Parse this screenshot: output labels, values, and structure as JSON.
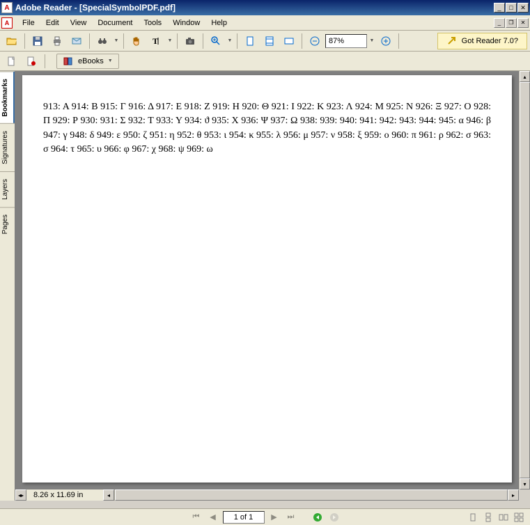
{
  "window": {
    "title": "Adobe Reader - [SpecialSymbolPDF.pdf]"
  },
  "menu": {
    "file": "File",
    "edit": "Edit",
    "view": "View",
    "document": "Document",
    "tools": "Tools",
    "window": "Window",
    "help": "Help"
  },
  "toolbar": {
    "zoom_value": "87%",
    "promo": "Got Reader 7.0?"
  },
  "toolbar2": {
    "ebooks": "eBooks"
  },
  "sidetabs": {
    "bookmarks": "Bookmarks",
    "signatures": "Signatures",
    "layers": "Layers",
    "pages": "Pages"
  },
  "document": {
    "content": " 913: Α 914: Β 915: Γ 916: Δ 917: Ε 918: Ζ 919: Η 920: Θ 921: Ι 922: Κ 923: Λ 924: Μ 925: Ν 926: Ξ 927: Ο 928: Π 929: Ρ 930:  931: Σ 932: Τ 933: Υ 934: ϑ 935: Χ 936: Ψ 937: Ω 938:  939:  940:  941:  942:  943:  944:  945: α 946: β 947: γ 948: δ 949: ε 950: ζ 951: η 952: θ 953: ι 954: κ 955: λ 956: μ 957: ν 958: ξ 959: ο 960: π 961: ρ 962: σ 963: σ 964: τ 965: υ 966: φ 967: χ 968: ψ 969: ω"
  },
  "status": {
    "dimensions": "8.26 x 11.69 in",
    "page_indicator": "1 of 1"
  }
}
